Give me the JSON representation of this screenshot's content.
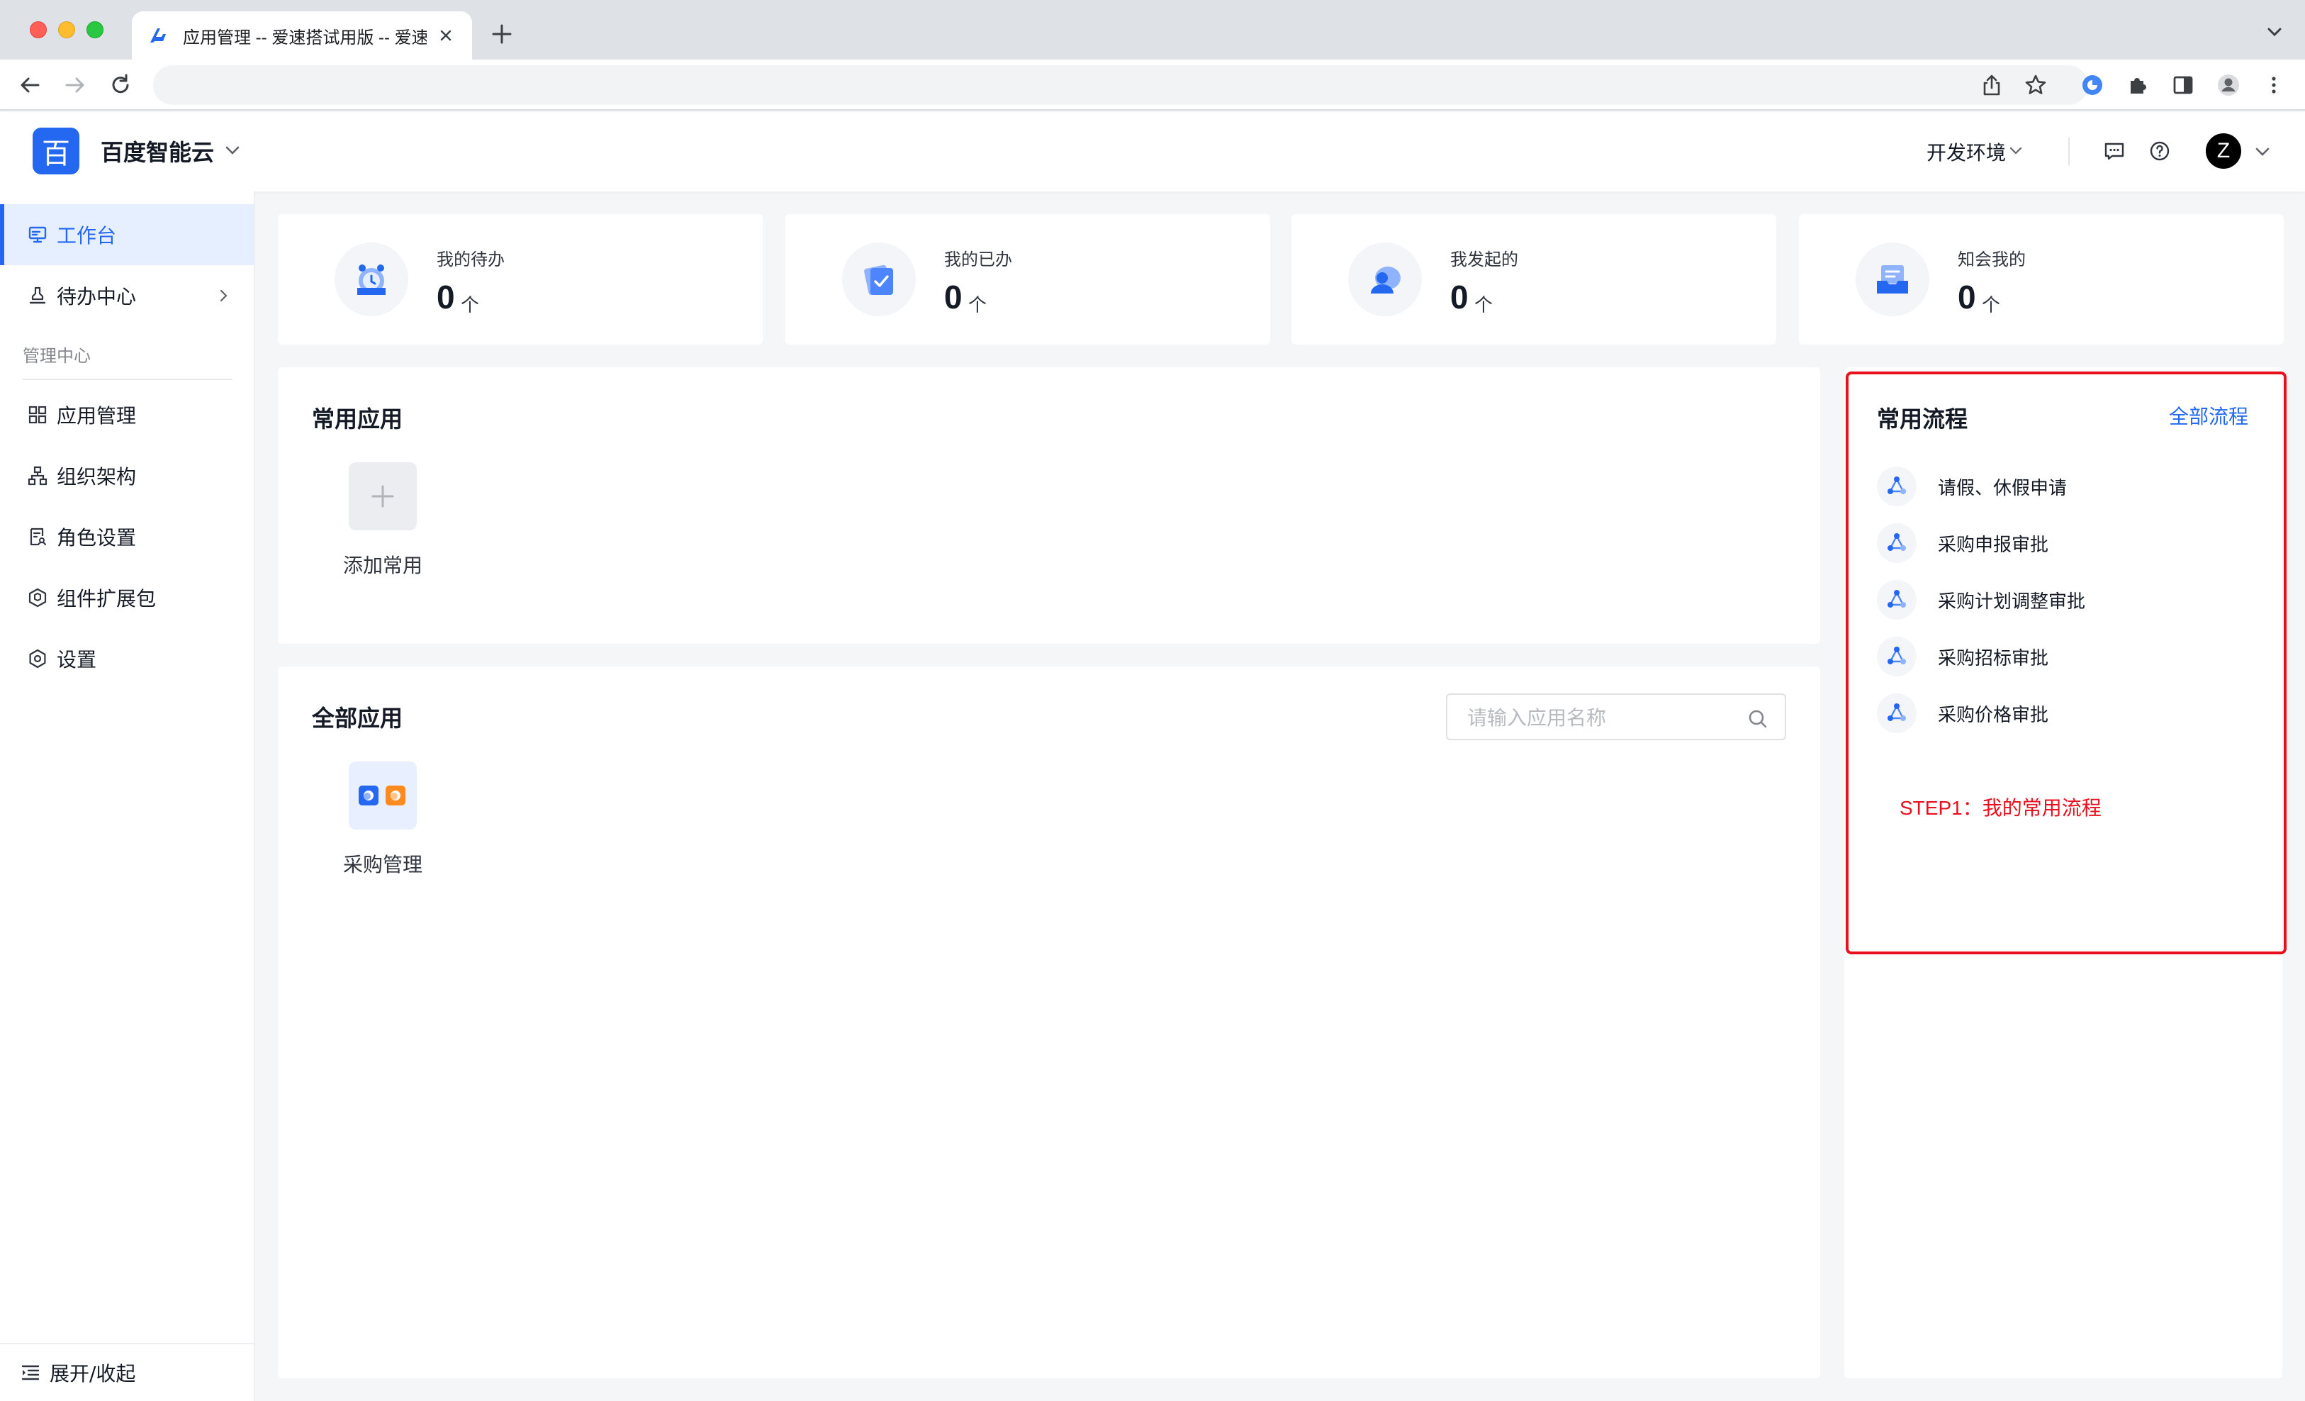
{
  "browser": {
    "tab_title": "应用管理 -- 爱速搭试用版 -- 爱速"
  },
  "header": {
    "logo_char": "百",
    "brand": "百度智能云",
    "environment": "开发环境",
    "avatar_letter": "Z"
  },
  "sidebar": {
    "items": [
      {
        "label": "工作台",
        "icon": "monitor-icon",
        "active": true
      },
      {
        "label": "待办中心",
        "icon": "stamp-icon",
        "has_children": true
      }
    ],
    "group_label": "管理中心",
    "admin_items": [
      {
        "label": "应用管理",
        "icon": "grid-icon"
      },
      {
        "label": "组织架构",
        "icon": "org-tree-icon"
      },
      {
        "label": "角色设置",
        "icon": "role-doc-icon"
      },
      {
        "label": "组件扩展包",
        "icon": "package-icon"
      },
      {
        "label": "设置",
        "icon": "settings-icon"
      }
    ],
    "footer_label": "展开/收起"
  },
  "stats": [
    {
      "label": "我的待办",
      "value": "0",
      "unit": "个",
      "icon": "alarm-clock-icon"
    },
    {
      "label": "我的已办",
      "value": "0",
      "unit": "个",
      "icon": "done-check-icon"
    },
    {
      "label": "我发起的",
      "value": "0",
      "unit": "个",
      "icon": "user-chat-icon"
    },
    {
      "label": "知会我的",
      "value": "0",
      "unit": "个",
      "icon": "inbox-icon"
    }
  ],
  "common_apps": {
    "title": "常用应用",
    "add_label": "添加常用"
  },
  "all_apps": {
    "title": "全部应用",
    "search_placeholder": "请输入应用名称",
    "apps": [
      {
        "label": "采购管理",
        "icon": "purchase-app-icon"
      }
    ]
  },
  "common_flows": {
    "title": "常用流程",
    "all_link": "全部流程",
    "items": [
      "请假、休假申请",
      "采购申报审批",
      "采购计划调整审批",
      "采购招标审批",
      "采购价格审批"
    ],
    "annotation": "STEP1：我的常用流程"
  },
  "colors": {
    "accent": "#2468f2",
    "annotation_red": "#e8101d",
    "page_bg": "#f5f6f8"
  }
}
